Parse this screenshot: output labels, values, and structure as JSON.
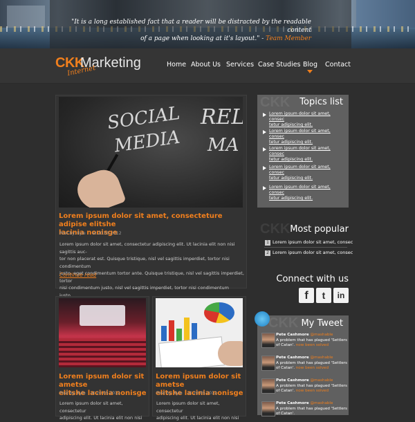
{
  "banner": {
    "quote_line1": "\"It is a long established fact that a reader will be distracted by the readable content",
    "quote_line2": "of a page when looking at it's layout.\" - ",
    "quote_author": "Team Member"
  },
  "logo": {
    "ckk": "CKK",
    "marketing": "Marketing",
    "internet": "Internet"
  },
  "nav": {
    "items": [
      "Home",
      "About Us",
      "Services",
      "Case Studies",
      "Blog",
      "Contact"
    ],
    "active": "Blog"
  },
  "main_post": {
    "image_words": [
      "SOCIAL",
      "MEDIA",
      "REL",
      "MA"
    ],
    "title_line1": "Lorem ipsum dolor sit amet, consecteture adipise elitshe",
    "title_line2": "lacinia nonisge",
    "author": "Post by: Kyle",
    "date": "at 20.05.2012",
    "body": [
      "Lorem ipsum dolor sit amet, consectetur adipiscing elit. Ut lacinia elit non nisi sagittis auc-",
      "tor non placerat est. Quisque tristique, nisl vel sagittis imperdiet, tortor nisi condimentum",
      "justo, eget condimentum tortor ante. Quisque tristique, nisl vel sagittis imperdiet, tortor",
      "nisi condimentum justo, nisl vel sagittis imperdiet, tortor nisi condimentum justo..."
    ],
    "continue": "Continue read"
  },
  "posts": [
    {
      "title_line1": "Lorem ipsum dolor sit ametse",
      "title_line2": "elitshe lacinia nonisge",
      "author": "Post by: Kyle",
      "date": "at 20.05.2012",
      "body_line1": "Lorem ipsum dolor sit amet, consectetur",
      "body_line2": "adipiscing elit. Ut lacinia elit non nisi"
    },
    {
      "title_line1": "Lorem ipsum dolor sit ametse",
      "title_line2": "elitshe lacinia nonisge",
      "author": "Post by: Kyle",
      "date": "at 20.05.2012",
      "body_line1": "Lorem ipsum dolor sit amet, consectetur",
      "body_line2": "adipiscing elit. Ut lacinia elit non nisi"
    }
  ],
  "topics": {
    "watermark": "CKK",
    "heading": "Topics list",
    "items": [
      {
        "line1": "Lorem ipsum dolor sit amet, consec",
        "line2": "tetur adipiscing elit."
      },
      {
        "line1": "Lorem ipsum dolor sit amet, consec",
        "line2": "tetur adipiscing elit."
      },
      {
        "line1": "Lorem ipsum dolor sit amet, consec",
        "line2": "tetur adipiscing elit."
      },
      {
        "line1": "Lorem ipsum dolor sit amet, consec",
        "line2": "tetur adipiscing elit."
      },
      {
        "line1": "Lorem ipsum dolor sit amet, consec",
        "line2": "tetur adipiscing elit."
      }
    ]
  },
  "popular": {
    "watermark": "CKK",
    "heading": "Most popular",
    "items": [
      {
        "num": "1",
        "text": "Lorem ipsum dolor sit amet, consec"
      },
      {
        "num": "2",
        "text": "Lorem ipsum dolor sit amet, consec"
      }
    ]
  },
  "connect": {
    "heading": "Connect with us",
    "buttons": [
      {
        "label": "f",
        "icon": "facebook-icon"
      },
      {
        "label": "t",
        "icon": "twitter-icon"
      },
      {
        "label": "in",
        "icon": "linkedin-icon"
      }
    ]
  },
  "tweets": {
    "watermark": "CKK",
    "heading": "My Tweet",
    "items": [
      {
        "user": "Pete Cashmore",
        "handle": "@mashable",
        "line1": "A problem that has plagued 'Settlers",
        "line2": "of Catan'. ",
        "link": "now been solved"
      },
      {
        "user": "Pete Cashmore",
        "handle": "@mashable",
        "line1": "A problem that has plagued 'Settlers",
        "line2": "of Catan'. ",
        "link": "now been solved"
      },
      {
        "user": "Pete Cashmore",
        "handle": "@mashable",
        "line1": "A problem that has plagued 'Settlers",
        "line2": "of Catan'. ",
        "link": "now been solved"
      },
      {
        "user": "Pete Cashmore",
        "handle": "@mashable",
        "line1": "A problem that has plagued 'Settlers",
        "line2": "of Catan'."
      }
    ]
  },
  "colors": {
    "accent": "#f07f1d",
    "background": "#2e2e2e",
    "sidebar_box": "#606060"
  }
}
